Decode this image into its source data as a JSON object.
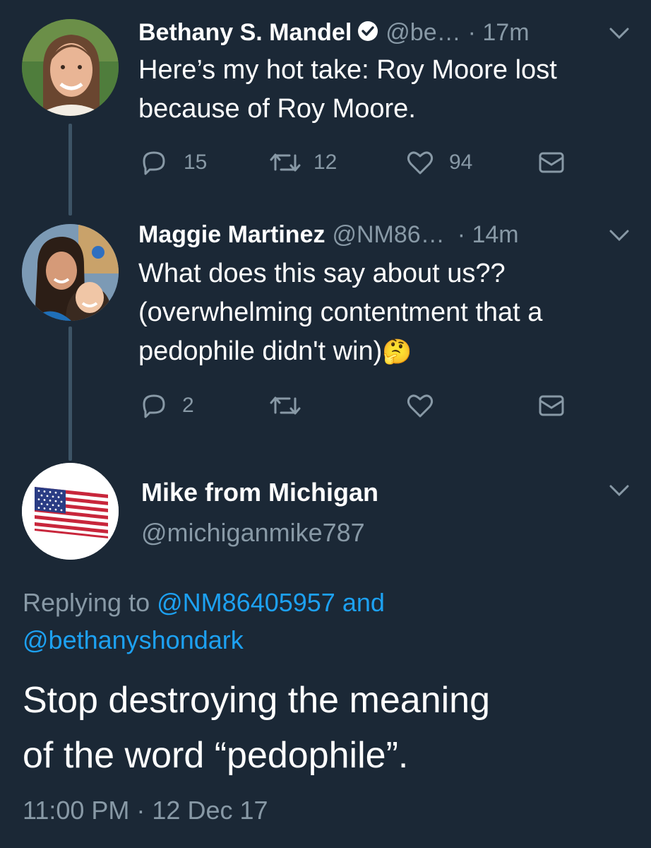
{
  "thread": [
    {
      "name": "Bethany S. Mandel",
      "handle": "@be…",
      "time": "· 17m",
      "text_lines": [
        "Here’s my hot take: Roy Moore lost",
        "because of Roy Moore."
      ],
      "replies": "15",
      "retweets": "12",
      "likes": "94",
      "verified": true,
      "avatar_icon": "woman-portrait-avatar"
    },
    {
      "name": "Maggie Martinez",
      "handle": "@NM86…",
      "time": "· 14m",
      "text_lines": [
        "What does this say about us??",
        "(overwhelming contentment that a",
        "pedophile didn't win)"
      ],
      "emoji": "🤔",
      "replies": "2",
      "retweets": "",
      "likes": "",
      "avatar_icon": "family-photo-avatar"
    }
  ],
  "main_tweet": {
    "name": "Mike from Michigan",
    "handle": "@michiganmike787",
    "avatar_icon": "us-flag-avatar",
    "replying_prefix": "Replying to",
    "replying_to_1": "@NM86405957",
    "replying_and": "and",
    "replying_to_2": "@bethanyshondark",
    "text_lines": [
      "Stop destroying the meaning",
      "of the word “pedophile”."
    ],
    "timestamp": "11:00 PM · 12 Dec 17"
  },
  "colors": {
    "background": "#1b2836",
    "muted": "#8899a6",
    "link": "#1da1f2",
    "thread_line": "#3d5466"
  }
}
